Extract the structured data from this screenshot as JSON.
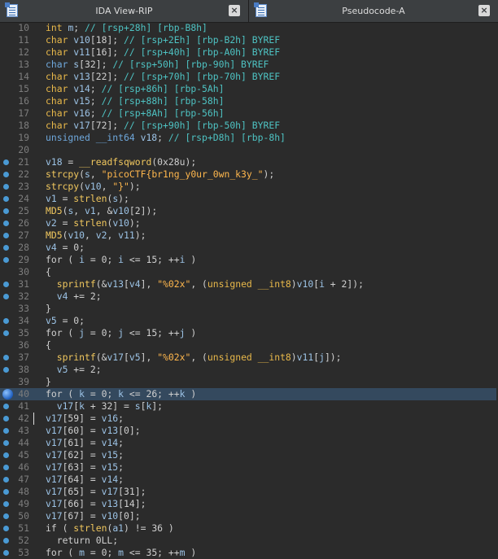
{
  "tabs": [
    {
      "title": "IDA View-RIP",
      "icon": "disassembly-view-icon",
      "close": "×"
    },
    {
      "title": "Pseudocode-A",
      "icon": "pseudocode-view-icon",
      "close": "×"
    }
  ],
  "breakpoint_line": 40,
  "highlighted_line": 40,
  "lines": [
    {
      "n": "10",
      "bp": false,
      "tokens": [
        [
          "typem",
          "int "
        ],
        [
          "var",
          "m"
        ],
        [
          "kw",
          "; "
        ],
        [
          "com",
          "// [rsp+28h] [rbp-B8h]"
        ]
      ]
    },
    {
      "n": "11",
      "bp": false,
      "tokens": [
        [
          "typem",
          "char "
        ],
        [
          "var",
          "v10"
        ],
        [
          "kw",
          "[18]; "
        ],
        [
          "com",
          "// [rsp+2Eh] [rbp-B2h] BYREF"
        ]
      ]
    },
    {
      "n": "12",
      "bp": false,
      "tokens": [
        [
          "typem",
          "char "
        ],
        [
          "var",
          "v11"
        ],
        [
          "kw",
          "[16]; "
        ],
        [
          "com",
          "// [rsp+40h] [rbp-A0h] BYREF"
        ]
      ]
    },
    {
      "n": "13",
      "bp": false,
      "tokens": [
        [
          "type",
          "char "
        ],
        [
          "var",
          "s"
        ],
        [
          "kw",
          "[32]; "
        ],
        [
          "com",
          "// [rsp+50h] [rbp-90h] BYREF"
        ]
      ]
    },
    {
      "n": "14",
      "bp": false,
      "tokens": [
        [
          "typem",
          "char "
        ],
        [
          "var",
          "v13"
        ],
        [
          "kw",
          "[22]; "
        ],
        [
          "com",
          "// [rsp+70h] [rbp-70h] BYREF"
        ]
      ]
    },
    {
      "n": "15",
      "bp": false,
      "tokens": [
        [
          "typem",
          "char "
        ],
        [
          "var",
          "v14"
        ],
        [
          "kw",
          "; "
        ],
        [
          "com",
          "// [rsp+86h] [rbp-5Ah]"
        ]
      ]
    },
    {
      "n": "16",
      "bp": false,
      "tokens": [
        [
          "typem",
          "char "
        ],
        [
          "var",
          "v15"
        ],
        [
          "kw",
          "; "
        ],
        [
          "com",
          "// [rsp+88h] [rbp-58h]"
        ]
      ]
    },
    {
      "n": "17",
      "bp": false,
      "tokens": [
        [
          "typem",
          "char "
        ],
        [
          "var",
          "v16"
        ],
        [
          "kw",
          "; "
        ],
        [
          "com",
          "// [rsp+8Ah] [rbp-56h]"
        ]
      ]
    },
    {
      "n": "18",
      "bp": false,
      "tokens": [
        [
          "typem",
          "char "
        ],
        [
          "var",
          "v17"
        ],
        [
          "kw",
          "[72]; "
        ],
        [
          "com",
          "// [rsp+90h] [rbp-50h] BYREF"
        ]
      ]
    },
    {
      "n": "19",
      "bp": false,
      "tokens": [
        [
          "type",
          "unsigned __int64 "
        ],
        [
          "var",
          "v18"
        ],
        [
          "kw",
          "; "
        ],
        [
          "com",
          "// [rsp+D8h] [rbp-8h]"
        ]
      ]
    },
    {
      "n": "20",
      "bp": false,
      "tokens": []
    },
    {
      "n": "21",
      "bp": true,
      "tokens": [
        [
          "var",
          "v18"
        ],
        [
          "kw",
          " = "
        ],
        [
          "fn",
          "__readfsqword"
        ],
        [
          "kw",
          "(0x28u);"
        ]
      ]
    },
    {
      "n": "22",
      "bp": true,
      "tokens": [
        [
          "fn",
          "strcpy"
        ],
        [
          "kw",
          "("
        ],
        [
          "var",
          "s"
        ],
        [
          "kw",
          ", "
        ],
        [
          "str",
          "\"picoCTF{br1ng_y0ur_0wn_k3y_\""
        ],
        [
          "kw",
          ");"
        ]
      ]
    },
    {
      "n": "23",
      "bp": true,
      "tokens": [
        [
          "fn",
          "strcpy"
        ],
        [
          "kw",
          "("
        ],
        [
          "var",
          "v10"
        ],
        [
          "kw",
          ", "
        ],
        [
          "str",
          "\"}\""
        ],
        [
          "kw",
          ");"
        ]
      ]
    },
    {
      "n": "24",
      "bp": true,
      "tokens": [
        [
          "var",
          "v1"
        ],
        [
          "kw",
          " = "
        ],
        [
          "fn",
          "strlen"
        ],
        [
          "kw",
          "("
        ],
        [
          "var",
          "s"
        ],
        [
          "kw",
          ");"
        ]
      ]
    },
    {
      "n": "25",
      "bp": true,
      "tokens": [
        [
          "fn",
          "MD5"
        ],
        [
          "kw",
          "("
        ],
        [
          "var",
          "s"
        ],
        [
          "kw",
          ", "
        ],
        [
          "var",
          "v1"
        ],
        [
          "kw",
          ", &"
        ],
        [
          "var",
          "v10"
        ],
        [
          "kw",
          "[2]);"
        ]
      ]
    },
    {
      "n": "26",
      "bp": true,
      "tokens": [
        [
          "var",
          "v2"
        ],
        [
          "kw",
          " = "
        ],
        [
          "fn",
          "strlen"
        ],
        [
          "kw",
          "("
        ],
        [
          "var",
          "v10"
        ],
        [
          "kw",
          ");"
        ]
      ]
    },
    {
      "n": "27",
      "bp": true,
      "tokens": [
        [
          "fn",
          "MD5"
        ],
        [
          "kw",
          "("
        ],
        [
          "var",
          "v10"
        ],
        [
          "kw",
          ", "
        ],
        [
          "var",
          "v2"
        ],
        [
          "kw",
          ", "
        ],
        [
          "var",
          "v11"
        ],
        [
          "kw",
          ");"
        ]
      ]
    },
    {
      "n": "28",
      "bp": true,
      "tokens": [
        [
          "var",
          "v4"
        ],
        [
          "kw",
          " = 0;"
        ]
      ]
    },
    {
      "n": "29",
      "bp": true,
      "tokens": [
        [
          "kw",
          "for ( "
        ],
        [
          "var",
          "i"
        ],
        [
          "kw",
          " = 0; "
        ],
        [
          "var",
          "i"
        ],
        [
          "kw",
          " <= 15; ++"
        ],
        [
          "var",
          "i"
        ],
        [
          "kw",
          " )"
        ]
      ]
    },
    {
      "n": "30",
      "bp": false,
      "tokens": [
        [
          "kw",
          "{"
        ]
      ]
    },
    {
      "n": "31",
      "bp": true,
      "tokens": [
        [
          "kw",
          "  "
        ],
        [
          "fn",
          "sprintf"
        ],
        [
          "kw",
          "(&"
        ],
        [
          "var",
          "v13"
        ],
        [
          "kw",
          "["
        ],
        [
          "var",
          "v4"
        ],
        [
          "kw",
          "], "
        ],
        [
          "str",
          "\"%02x\""
        ],
        [
          "kw",
          ", ("
        ],
        [
          "typem",
          "unsigned __int8"
        ],
        [
          "kw",
          ")"
        ],
        [
          "var",
          "v10"
        ],
        [
          "kw",
          "["
        ],
        [
          "var",
          "i"
        ],
        [
          "kw",
          " + 2]);"
        ]
      ]
    },
    {
      "n": "32",
      "bp": true,
      "tokens": [
        [
          "kw",
          "  "
        ],
        [
          "var",
          "v4"
        ],
        [
          "kw",
          " += 2;"
        ]
      ]
    },
    {
      "n": "33",
      "bp": false,
      "tokens": [
        [
          "kw",
          "}"
        ]
      ]
    },
    {
      "n": "34",
      "bp": true,
      "tokens": [
        [
          "var",
          "v5"
        ],
        [
          "kw",
          " = 0;"
        ]
      ]
    },
    {
      "n": "35",
      "bp": true,
      "tokens": [
        [
          "kw",
          "for ( "
        ],
        [
          "var",
          "j"
        ],
        [
          "kw",
          " = 0; "
        ],
        [
          "var",
          "j"
        ],
        [
          "kw",
          " <= 15; ++"
        ],
        [
          "var",
          "j"
        ],
        [
          "kw",
          " )"
        ]
      ]
    },
    {
      "n": "36",
      "bp": false,
      "tokens": [
        [
          "kw",
          "{"
        ]
      ]
    },
    {
      "n": "37",
      "bp": true,
      "tokens": [
        [
          "kw",
          "  "
        ],
        [
          "fn",
          "sprintf"
        ],
        [
          "kw",
          "(&"
        ],
        [
          "var",
          "v17"
        ],
        [
          "kw",
          "["
        ],
        [
          "var",
          "v5"
        ],
        [
          "kw",
          "], "
        ],
        [
          "str",
          "\"%02x\""
        ],
        [
          "kw",
          ", ("
        ],
        [
          "typem",
          "unsigned __int8"
        ],
        [
          "kw",
          ")"
        ],
        [
          "var",
          "v11"
        ],
        [
          "kw",
          "["
        ],
        [
          "var",
          "j"
        ],
        [
          "kw",
          "]);"
        ]
      ]
    },
    {
      "n": "38",
      "bp": true,
      "tokens": [
        [
          "kw",
          "  "
        ],
        [
          "var",
          "v5"
        ],
        [
          "kw",
          " += 2;"
        ]
      ]
    },
    {
      "n": "39",
      "bp": false,
      "tokens": [
        [
          "kw",
          "}"
        ]
      ]
    },
    {
      "n": "40",
      "bp": true,
      "tokens": [
        [
          "kw",
          "for ( "
        ],
        [
          "var",
          "k"
        ],
        [
          "kw",
          " = 0; "
        ],
        [
          "var",
          "k"
        ],
        [
          "kw",
          " <= 26; ++"
        ],
        [
          "var",
          "k"
        ],
        [
          "kw",
          " )"
        ]
      ]
    },
    {
      "n": "41",
      "bp": true,
      "tokens": [
        [
          "kw",
          "  "
        ],
        [
          "var",
          "v17"
        ],
        [
          "kw",
          "["
        ],
        [
          "var",
          "k"
        ],
        [
          "kw",
          " + 32] = "
        ],
        [
          "var",
          "s"
        ],
        [
          "kw",
          "["
        ],
        [
          "var",
          "k"
        ],
        [
          "kw",
          "];"
        ]
      ]
    },
    {
      "n": "42",
      "bp": true,
      "tokens": [
        [
          "var",
          "v17"
        ],
        [
          "kw",
          "[59] = "
        ],
        [
          "var",
          "v16"
        ],
        [
          "kw",
          ";"
        ]
      ]
    },
    {
      "n": "43",
      "bp": true,
      "tokens": [
        [
          "var",
          "v17"
        ],
        [
          "kw",
          "[60] = "
        ],
        [
          "var",
          "v13"
        ],
        [
          "kw",
          "[0];"
        ]
      ]
    },
    {
      "n": "44",
      "bp": true,
      "tokens": [
        [
          "var",
          "v17"
        ],
        [
          "kw",
          "[61] = "
        ],
        [
          "var",
          "v14"
        ],
        [
          "kw",
          ";"
        ]
      ]
    },
    {
      "n": "45",
      "bp": true,
      "tokens": [
        [
          "var",
          "v17"
        ],
        [
          "kw",
          "[62] = "
        ],
        [
          "var",
          "v15"
        ],
        [
          "kw",
          ";"
        ]
      ]
    },
    {
      "n": "46",
      "bp": true,
      "tokens": [
        [
          "var",
          "v17"
        ],
        [
          "kw",
          "[63] = "
        ],
        [
          "var",
          "v15"
        ],
        [
          "kw",
          ";"
        ]
      ]
    },
    {
      "n": "47",
      "bp": true,
      "tokens": [
        [
          "var",
          "v17"
        ],
        [
          "kw",
          "[64] = "
        ],
        [
          "var",
          "v14"
        ],
        [
          "kw",
          ";"
        ]
      ]
    },
    {
      "n": "48",
      "bp": true,
      "tokens": [
        [
          "var",
          "v17"
        ],
        [
          "kw",
          "[65] = "
        ],
        [
          "var",
          "v17"
        ],
        [
          "kw",
          "[31];"
        ]
      ]
    },
    {
      "n": "49",
      "bp": true,
      "tokens": [
        [
          "var",
          "v17"
        ],
        [
          "kw",
          "[66] = "
        ],
        [
          "var",
          "v13"
        ],
        [
          "kw",
          "[14];"
        ]
      ]
    },
    {
      "n": "50",
      "bp": true,
      "tokens": [
        [
          "var",
          "v17"
        ],
        [
          "kw",
          "[67] = "
        ],
        [
          "var",
          "v10"
        ],
        [
          "kw",
          "[0];"
        ]
      ]
    },
    {
      "n": "51",
      "bp": true,
      "tokens": [
        [
          "kw",
          "if ( "
        ],
        [
          "fn",
          "strlen"
        ],
        [
          "kw",
          "("
        ],
        [
          "var",
          "a1"
        ],
        [
          "kw",
          ") != 36 )"
        ]
      ]
    },
    {
      "n": "52",
      "bp": true,
      "tokens": [
        [
          "kw",
          "  return 0LL;"
        ]
      ]
    },
    {
      "n": "53",
      "bp": true,
      "tokens": [
        [
          "kw",
          "for ( "
        ],
        [
          "var",
          "m"
        ],
        [
          "kw",
          " = 0; "
        ],
        [
          "var",
          "m"
        ],
        [
          "kw",
          " <= 35; ++"
        ],
        [
          "var",
          "m"
        ],
        [
          "kw",
          " )"
        ]
      ]
    }
  ]
}
